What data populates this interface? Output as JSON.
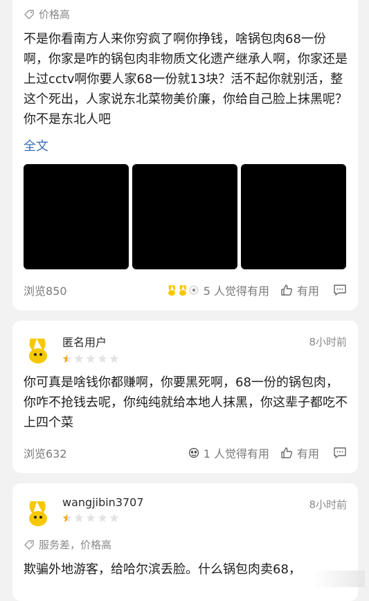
{
  "reviews": [
    {
      "tags": "价格高",
      "text": "不是你看南方人来你穷疯了啊你挣钱，啥锅包肉68一份啊，你家是咋的锅包肉非物质文化遗产继承人啊，你家还是上过cctv啊你要人家68一份就13块？活不起你就别活，整这个死出，人家说东北菜物美价廉，你给自己脸上抹黑呢？你不是东北人吧",
      "more": "全文",
      "views": "浏览850",
      "helpful": "5 人觉得有用",
      "useful": "有用"
    },
    {
      "user": "匿名用户",
      "time": "8小时前",
      "rating": 0.5,
      "text": "你可真是啥钱你都赚啊，你要黑死啊，68一份的锅包肉，你咋不抢钱去呢，你纯纯就给本地人抹黑，你这辈子都吃不上四个菜",
      "views": "浏览632",
      "helpful": "1 人觉得有用",
      "useful": "有用"
    },
    {
      "user": "wangjibin3707",
      "time": "8小时前",
      "rating": 0.5,
      "tags": "服务差，价格高",
      "text": "欺骗外地游客，给哈尔滨丢脸。什么锅包肉卖68，"
    }
  ],
  "colors": {
    "star_active": "#f5a623",
    "star_inactive": "#e3e3e3",
    "link": "#3d6fb5"
  },
  "icons": [
    "price-tag-icon",
    "thumbs-up-icon",
    "comment-icon",
    "avatar-icon"
  ]
}
